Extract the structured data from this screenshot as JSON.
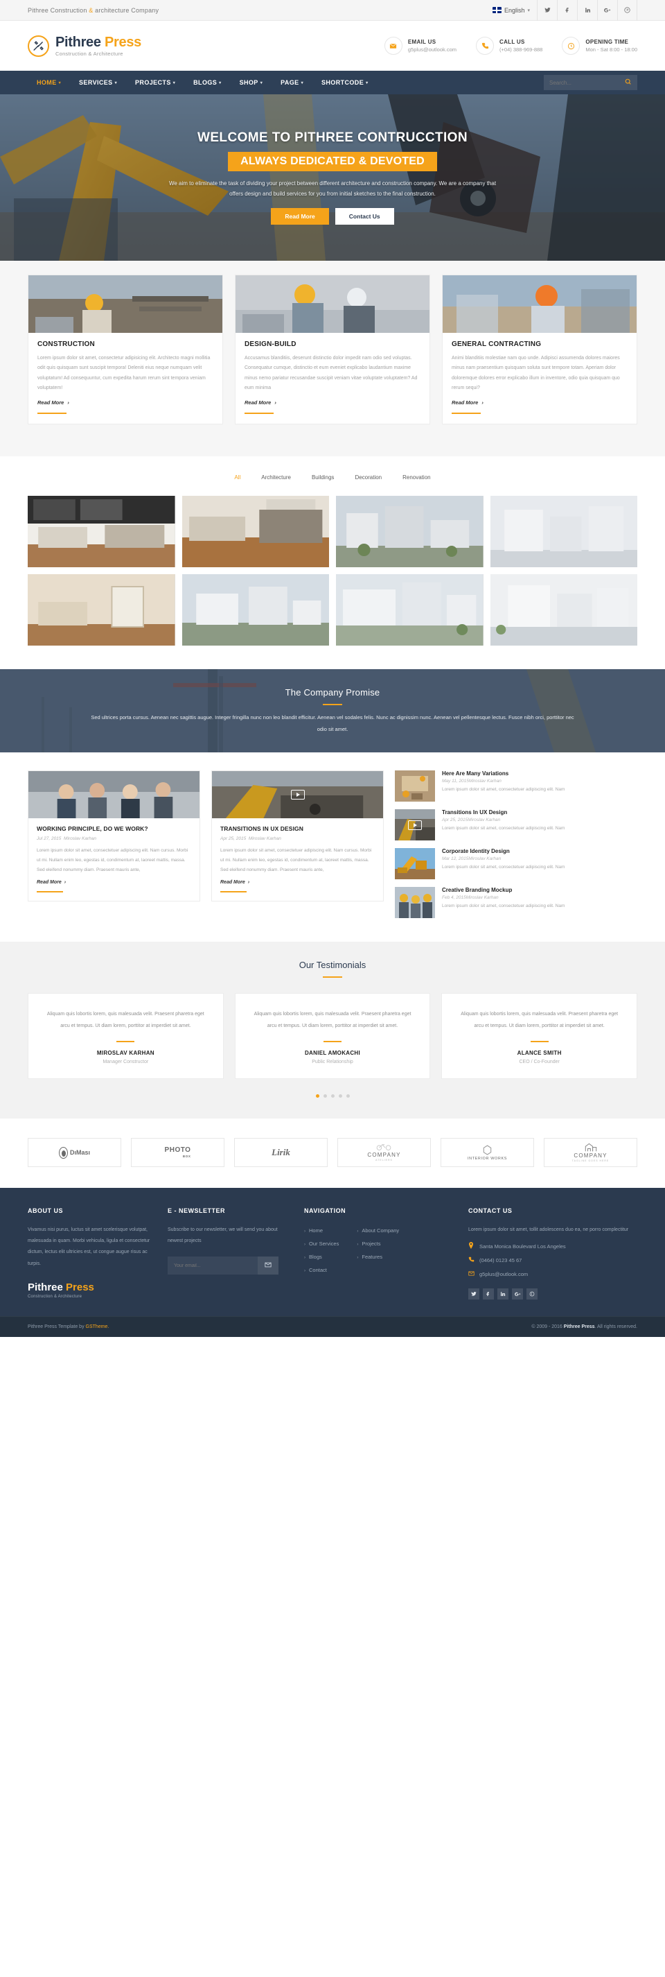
{
  "topbar": {
    "tagline_a": "Pithree Construction ",
    "tagline_amp": "&",
    "tagline_b": " architecture Company",
    "language": "English",
    "caret": "▾",
    "socials": [
      {
        "name": "twitter-icon",
        "glyph": "🐦"
      },
      {
        "name": "facebook-icon",
        "glyph": "f"
      },
      {
        "name": "linkedin-icon",
        "glyph": "in"
      },
      {
        "name": "google-plus-icon",
        "glyph": "G+"
      },
      {
        "name": "pinterest-icon",
        "glyph": "◉"
      }
    ]
  },
  "brand": {
    "name_first": "Pithree",
    "name_second": "Press",
    "tagline": "Construction & Architecture",
    "mark_icon": "tools-icon"
  },
  "header_info": [
    {
      "icon": "envelope-icon",
      "glyph": "✉",
      "label": "EMAIL US",
      "value": "g5plus@outlook.com"
    },
    {
      "icon": "phone-icon",
      "glyph": "✆",
      "label": "CALL US",
      "value": "(+04) 388-969-888"
    },
    {
      "icon": "clock-icon",
      "glyph": "◔",
      "label": "OPENING TIME",
      "value": "Mon - Sat 8:00 - 18:00"
    }
  ],
  "nav": {
    "items": [
      {
        "label": "HOME",
        "active": true
      },
      {
        "label": "SERVICES",
        "active": false
      },
      {
        "label": "PROJECTS",
        "active": false
      },
      {
        "label": "BLOGS",
        "active": false
      },
      {
        "label": "SHOP",
        "active": false
      },
      {
        "label": "PAGE",
        "active": false
      },
      {
        "label": "SHORTCODE",
        "active": false
      }
    ],
    "caret": "▾",
    "search_placeholder": "Search...",
    "search_value": "",
    "search_icon": "magnifier-icon"
  },
  "hero": {
    "heading": "WELCOME TO PITHREE CONTRUCCTION",
    "subheading": "ALWAYS DEDICATED & DEVOTED",
    "paragraph": "We aim to eliminate the task of dividing your project between different architecture and construction company. We are a company that offers design and build services for you from initial sketches to the final construction.",
    "btn_primary": "Read More",
    "btn_secondary": "Contact Us"
  },
  "services": [
    {
      "title": "CONSTRUCTION",
      "text": "Lorem ipsum dolor sit amet, consectetur adipisicing elit. Architecto magni mollitia odit quis quisquam sunt suscipit tempora! Deleniti eius neque numquam velit voluptatum! Ad consequuntur, cum expedita harum rerum sint tempora veniam voluptatem!",
      "more": "Read More",
      "arrow": "›"
    },
    {
      "title": "DESIGN-BUILD",
      "text": "Accusamus blanditiis, deserunt distinctio dolor impedit nam odio sed voluptas. Consequatur cumque, distinctio et eum eveniet explicabo laudantium maxime minus nemo pariatur recusandae suscipit veniam vitae voluptate voluptatem? Ad eum minima",
      "more": "Read More",
      "arrow": "›"
    },
    {
      "title": "GENERAL CONTRACTING",
      "text": "Animi blanditiis molestiae nam quo unde. Adipisci assumenda dolores maiores minus nam praesentium quisquam soluta sunt tempore totam. Aperiam dolor doloremque dolores error explicabo illum in inventore, odio quia quisquam quo rerum sequi?",
      "more": "Read More",
      "arrow": "›"
    }
  ],
  "portfolio": {
    "filters": [
      {
        "label": "All",
        "active": true
      },
      {
        "label": "Architecture",
        "active": false
      },
      {
        "label": "Buildings",
        "active": false
      },
      {
        "label": "Decoration",
        "active": false
      },
      {
        "label": "Renovation",
        "active": false
      }
    ]
  },
  "promise": {
    "heading": "The Company Promise",
    "paragraph": "Sed ultrices porta cursus. Aenean nec sagittis augue. Integer fringilla nunc non leo blandit efficitur. Aenean vel sodales felis. Nunc ac dignissim nunc. Aenean vel pellentesque lectus. Fusce nibh orci, porttitor nec odio sit amet."
  },
  "blog": {
    "cards": [
      {
        "title": "WORKING PRINCIPLE, DO WE WORK?",
        "date": "Jul 27, 2015",
        "author": "Miroslav Karhan",
        "text": "Lorem ipsum dolor sit amet, consectetuer adipiscing elit. Nam cursus. Morbi ut mi. Nullam enim leo, egestas id, condimentum at, laoreet mattis, massa. Sed eleifend nonummy diam. Praesent mauris ante,",
        "more": "Read More",
        "arrow": "›",
        "has_video": false
      },
      {
        "title": "TRANSITIONS IN UX DESIGN",
        "date": "Apr 25, 2015",
        "author": "Miroslav Karhan",
        "text": "Lorem ipsum dolor sit amet, consectetuer adipiscing elit. Nam cursus. Morbi ut mi. Nullam enim leo, egestas id, condimentum at, laoreet mattis, massa. Sed eleifend nonummy diam. Praesent mauris ante,",
        "more": "Read More",
        "arrow": "›",
        "has_video": true
      }
    ],
    "news": [
      {
        "title": "Here Are Many Variations",
        "meta": "May 11, 2015Miroslav Karhan",
        "text": "Lorem ipsum dolor sit amet, consectetuer adipiscing elit. Nam",
        "has_video": false
      },
      {
        "title": "Transitions In UX Design",
        "meta": "Apr 25, 2015Miroslav Karhan",
        "text": "Lorem ipsum dolor sit amet, consectetuer adipiscing elit. Nam",
        "has_video": true
      },
      {
        "title": "Corporate Identity Design",
        "meta": "Mar 12, 2015Miroslav Karhan",
        "text": "Lorem ipsum dolor sit amet, consectetuer adipiscing elit. Nam",
        "has_video": false
      },
      {
        "title": "Creative Branding Mockup",
        "meta": "Feb 4, 2015Miroslav Karhan",
        "text": "Lorem ipsum dolor sit amet, consectetuer adipiscing elit. Nam",
        "has_video": false
      }
    ]
  },
  "testimonials": {
    "heading": "Our Testimonials",
    "items": [
      {
        "quote": "Aliquam quis lobortis lorem, quis malesuada velit. Praesent pharetra eget arcu et tempus. Ut diam lorem, porttitor at imperdiet sit amet.",
        "name": "MIROSLAV KARHAN",
        "role": "Manager Constructor"
      },
      {
        "quote": "Aliquam quis lobortis lorem, quis malesuada velit. Praesent pharetra eget arcu et tempus. Ut diam lorem, porttitor at imperdiet sit amet.",
        "name": "DANIEL AMOKACHI",
        "role": "Public Relationship"
      },
      {
        "quote": "Aliquam quis lobortis lorem, quis malesuada velit. Praesent pharetra eget arcu et tempus. Ut diam lorem, porttitor at imperdiet sit amet.",
        "name": "ALANCE SMITH",
        "role": "CEO / Co-Founder"
      }
    ],
    "dots": [
      true,
      false,
      false,
      false,
      false
    ]
  },
  "clients": [
    {
      "name": "DıMası",
      "kind": "dimasi"
    },
    {
      "name": "PHOTO",
      "sub": "BOX",
      "kind": "photo"
    },
    {
      "name": "Lirik",
      "kind": "lirik"
    },
    {
      "name": "COMPANY",
      "sub": "ATELIERS",
      "kind": "company-bike"
    },
    {
      "name": "INTERIOR WORKS",
      "kind": "interior"
    },
    {
      "name": "COMPANY",
      "sub": "TAGLINE GOES HERE",
      "kind": "company-building"
    }
  ],
  "footer": {
    "about": {
      "heading": "ABOUT US",
      "text": "Vivamus nisi purus, luctus sit amet scelerisque volutpat, malesuada in quam. Morbi vehicula, ligula et consectetur dictum, lectus elit ultricies est, ut congue augue risus ac turpis."
    },
    "newsletter": {
      "heading": "E - NEWSLETTER",
      "text": "Subscribe to our newsletter, we will send you about newest projects",
      "placeholder": "Your email...",
      "value": "",
      "button_icon": "envelope-icon",
      "button_glyph": "✉"
    },
    "navigation": {
      "heading": "NAVIGATION",
      "col_a": [
        "Home",
        "Our Services",
        "Blogs",
        "Contact"
      ],
      "col_b": [
        "About Company",
        "Projects",
        "Features"
      ],
      "chevron": "›"
    },
    "contact": {
      "heading": "CONTACT US",
      "text": "Lorem ipsum dolor sit amet, tollit adolescens duo ea, ne porro complectitur",
      "lines": [
        {
          "icon": "location-pin-icon",
          "glyph": "⚲",
          "text": "Santa Monica Boulevard Los Angeles"
        },
        {
          "icon": "phone-icon",
          "glyph": "✆",
          "text": "(0464) 0123 45 67"
        },
        {
          "icon": "envelope-icon",
          "glyph": "✉",
          "text": "g5plus@outlook.com"
        }
      ],
      "socials": [
        {
          "name": "twitter-icon",
          "glyph": "🐦"
        },
        {
          "name": "facebook-icon",
          "glyph": "f"
        },
        {
          "name": "linkedin-icon",
          "glyph": "in"
        },
        {
          "name": "google-plus-icon",
          "glyph": "G+"
        },
        {
          "name": "pinterest-icon",
          "glyph": "◉"
        }
      ]
    }
  },
  "bottombar": {
    "left_a": "Pithree Press Template by ",
    "left_b": "GSTheme.",
    "right_a": "© 2009 - 2016 ",
    "right_b": "Pithree Press",
    "right_c": ". All rights reserved."
  }
}
